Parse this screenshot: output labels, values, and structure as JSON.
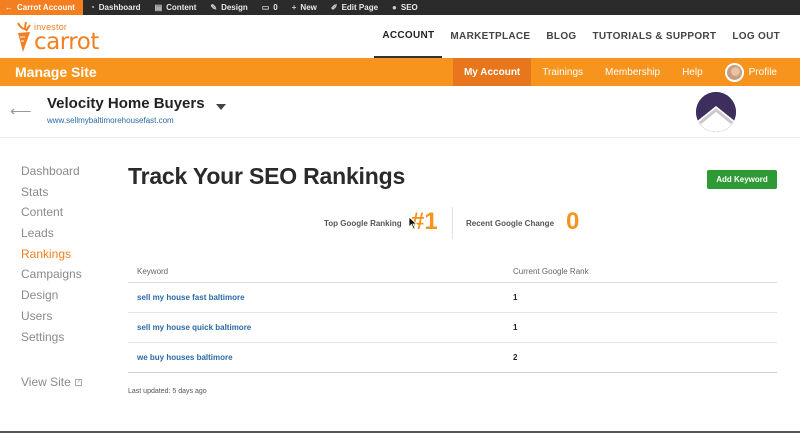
{
  "admin_bar": {
    "items": [
      {
        "label": "Carrot Account",
        "icon": "back-arrow-icon"
      },
      {
        "label": "Dashboard",
        "icon": "dashboard-icon"
      },
      {
        "label": "Content",
        "icon": "content-icon"
      },
      {
        "label": "Design",
        "icon": "design-icon"
      },
      {
        "label": "0",
        "icon": "comment-icon"
      },
      {
        "label": "New",
        "icon": "plus-icon"
      },
      {
        "label": "Edit Page",
        "icon": "pencil-icon"
      },
      {
        "label": "SEO",
        "icon": "seo-icon"
      }
    ]
  },
  "logo": {
    "small": "investor",
    "big": "carrot"
  },
  "top_nav": [
    "ACCOUNT",
    "MARKETPLACE",
    "BLOG",
    "TUTORIALS & SUPPORT",
    "LOG OUT"
  ],
  "manage_bar": {
    "title": "Manage Site",
    "items": [
      "My Account",
      "Trainings",
      "Membership",
      "Help",
      "Profile"
    ]
  },
  "site": {
    "name": "Velocity Home Buyers",
    "url": "www.sellmybaltimorehousefast.com"
  },
  "sidebar": {
    "items": [
      "Dashboard",
      "Stats",
      "Content",
      "Leads",
      "Rankings",
      "Campaigns",
      "Design",
      "Users",
      "Settings"
    ],
    "active": "Rankings",
    "view_site": "View Site"
  },
  "main": {
    "title": "Track Your SEO Rankings",
    "add_keyword": "Add Keyword",
    "stats": {
      "top_rank_label": "Top Google Ranking",
      "top_rank_value": "#1",
      "recent_change_label": "Recent Google Change",
      "recent_change_value": "0"
    },
    "table": {
      "headers": [
        "Keyword",
        "Current Google Rank"
      ],
      "rows": [
        {
          "keyword": "sell my house fast baltimore",
          "rank": "1"
        },
        {
          "keyword": "sell my house quick baltimore",
          "rank": "1"
        },
        {
          "keyword": "we buy houses baltimore",
          "rank": "2"
        }
      ]
    },
    "last_updated": "Last updated: 5 days ago"
  },
  "colors": {
    "orange": "#f7941d",
    "green": "#2e9a35",
    "link": "#2a6aa8"
  }
}
